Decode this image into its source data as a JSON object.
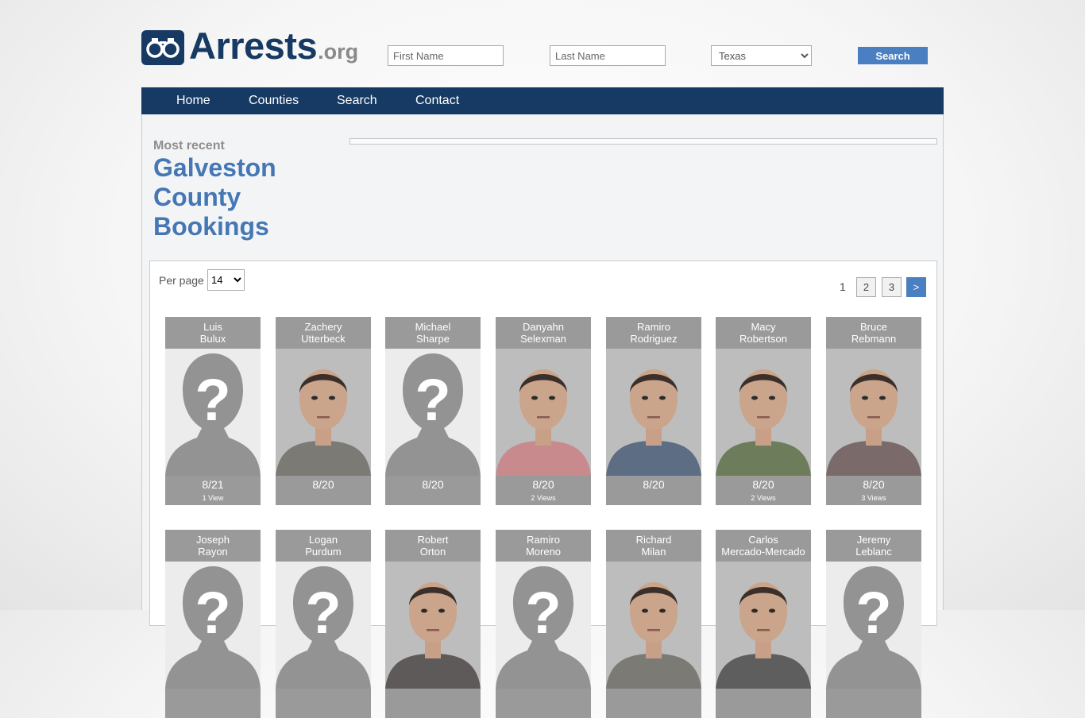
{
  "site": {
    "name": "Arrests",
    "tld": ".org"
  },
  "search": {
    "first_placeholder": "First Name",
    "last_placeholder": "Last Name",
    "state_selected": "Texas",
    "button_label": "Search"
  },
  "nav": [
    "Home",
    "Counties",
    "Search",
    "Contact"
  ],
  "heading": {
    "kicker": "Most recent",
    "title": "Galveston County Bookings"
  },
  "controls": {
    "per_page_label": "Per page",
    "per_page_value": "14",
    "pages": [
      "1",
      "2",
      "3",
      ">"
    ]
  },
  "bookings": [
    {
      "first": "Luis",
      "last": "Bulux",
      "date": "8/21",
      "views": "1 View",
      "photo": "placeholder"
    },
    {
      "first": "Zachery",
      "last": "Utterbeck",
      "date": "8/20",
      "views": "",
      "photo": "mugshot"
    },
    {
      "first": "Michael",
      "last": "Sharpe",
      "date": "8/20",
      "views": "",
      "photo": "placeholder"
    },
    {
      "first": "Danyahn",
      "last": "Selexman",
      "date": "8/20",
      "views": "2 Views",
      "photo": "mugshot"
    },
    {
      "first": "Ramiro",
      "last": "Rodriguez",
      "date": "8/20",
      "views": "",
      "photo": "mugshot"
    },
    {
      "first": "Macy",
      "last": "Robertson",
      "date": "8/20",
      "views": "2 Views",
      "photo": "mugshot"
    },
    {
      "first": "Bruce",
      "last": "Rebmann",
      "date": "8/20",
      "views": "3 Views",
      "photo": "mugshot"
    },
    {
      "first": "Joseph",
      "last": "Rayon",
      "date": "",
      "views": "",
      "photo": "placeholder"
    },
    {
      "first": "Logan",
      "last": "Purdum",
      "date": "",
      "views": "",
      "photo": "placeholder"
    },
    {
      "first": "Robert",
      "last": "Orton",
      "date": "",
      "views": "",
      "photo": "mugshot"
    },
    {
      "first": "Ramiro",
      "last": "Moreno",
      "date": "",
      "views": "",
      "photo": "placeholder"
    },
    {
      "first": "Richard",
      "last": "Milan",
      "date": "",
      "views": "",
      "photo": "mugshot"
    },
    {
      "first": "Carlos",
      "last": "Mercado-Mercado",
      "date": "",
      "views": "",
      "photo": "mugshot"
    },
    {
      "first": "Jeremy",
      "last": "Leblanc",
      "date": "",
      "views": "",
      "photo": "placeholder"
    }
  ],
  "colors": {
    "brand_navy": "#163a63",
    "accent_blue": "#4577b5",
    "button_blue": "#4a7fc1",
    "card_gray": "#9a9a9a"
  }
}
